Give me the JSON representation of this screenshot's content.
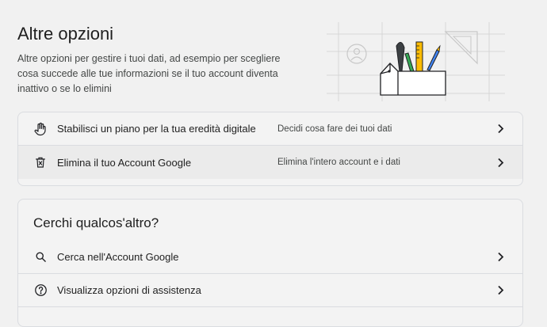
{
  "header": {
    "title": "Altre opzioni",
    "description": "Altre opzioni per gestire i tuoi dati, ad esempio per scegliere cosa succede alle tue informazioni se il tuo account diventa inattivo o se lo elimini"
  },
  "options_card": {
    "rows": [
      {
        "label": "Stabilisci un piano per la tua eredità digitale",
        "sub": "Decidi cosa fare dei tuoi dati",
        "icon": "hand-icon"
      },
      {
        "label": "Elimina il tuo Account Google",
        "sub": "Elimina l'intero account e i dati",
        "icon": "delete-icon"
      }
    ]
  },
  "help_card": {
    "title": "Cerchi qualcos'altro?",
    "rows": [
      {
        "label": "Cerca nell'Account Google",
        "icon": "search-icon"
      },
      {
        "label": "Visualizza opzioni di assistenza",
        "icon": "help-icon"
      }
    ]
  },
  "colors": {
    "accent_blue": "#1a73e8",
    "accent_yellow": "#fbbc04",
    "accent_green": "#34a853",
    "text": "#1f1f1f"
  }
}
